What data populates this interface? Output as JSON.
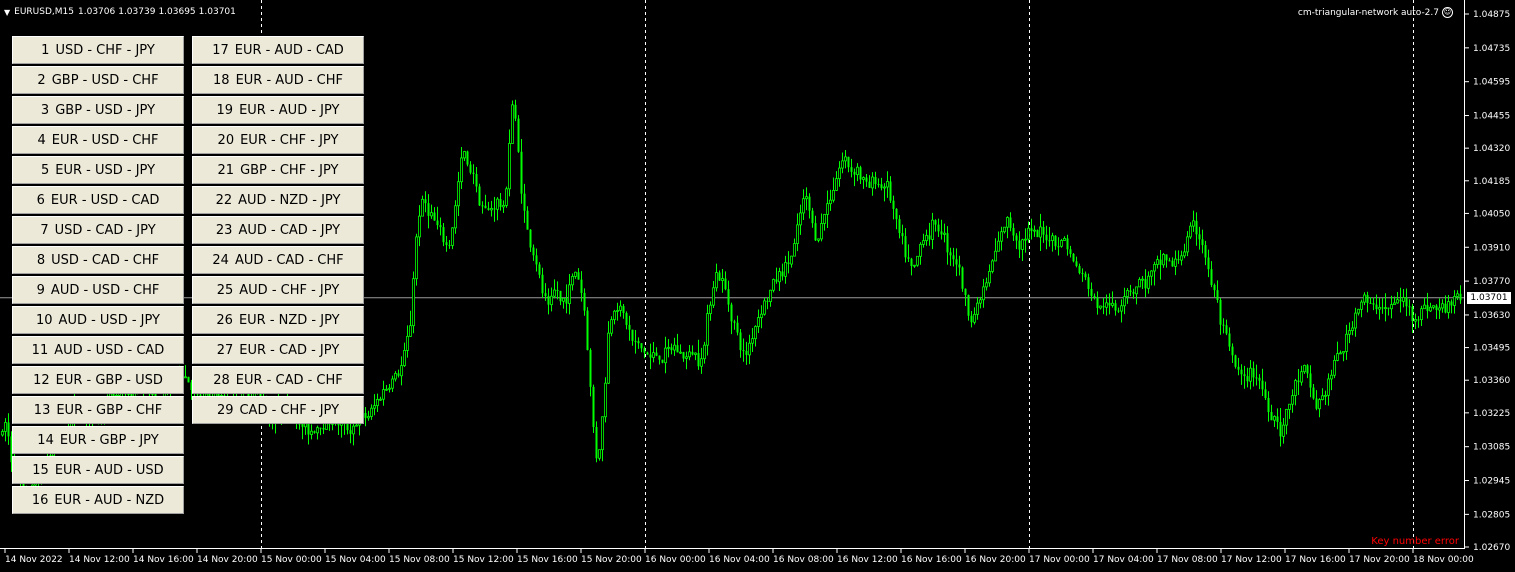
{
  "header": {
    "symbol": "EURUSD,M15",
    "quotes": [
      "1.03706",
      "1.03739",
      "1.03695",
      "1.03701"
    ]
  },
  "indicator": {
    "name": "cm-triangular-network auto-2.7",
    "icon": "smiley-icon"
  },
  "status_message": "Key number error",
  "triangles": [
    {
      "num": "1",
      "pair": "USD - CHF - JPY"
    },
    {
      "num": "2",
      "pair": "GBP - USD - CHF"
    },
    {
      "num": "3",
      "pair": "GBP - USD - JPY"
    },
    {
      "num": "4",
      "pair": "EUR - USD - CHF"
    },
    {
      "num": "5",
      "pair": "EUR - USD - JPY"
    },
    {
      "num": "6",
      "pair": "EUR - USD - CAD"
    },
    {
      "num": "7",
      "pair": "USD - CAD - JPY"
    },
    {
      "num": "8",
      "pair": "USD - CAD - CHF"
    },
    {
      "num": "9",
      "pair": "AUD - USD - CHF"
    },
    {
      "num": "10",
      "pair": "AUD - USD - JPY"
    },
    {
      "num": "11",
      "pair": "AUD - USD - CAD"
    },
    {
      "num": "12",
      "pair": "EUR - GBP - USD"
    },
    {
      "num": "13",
      "pair": "EUR - GBP - CHF"
    },
    {
      "num": "14",
      "pair": "EUR - GBP - JPY"
    },
    {
      "num": "15",
      "pair": "EUR - AUD - USD"
    },
    {
      "num": "16",
      "pair": "EUR - AUD - NZD"
    },
    {
      "num": "17",
      "pair": "EUR - AUD - CAD"
    },
    {
      "num": "18",
      "pair": "EUR - AUD - CHF"
    },
    {
      "num": "19",
      "pair": "EUR - AUD - JPY"
    },
    {
      "num": "20",
      "pair": "EUR - CHF - JPY"
    },
    {
      "num": "21",
      "pair": "GBP - CHF - JPY"
    },
    {
      "num": "22",
      "pair": "AUD - NZD - JPY"
    },
    {
      "num": "23",
      "pair": "AUD - CAD - JPY"
    },
    {
      "num": "24",
      "pair": "AUD - CAD - CHF"
    },
    {
      "num": "25",
      "pair": "AUD - CHF - JPY"
    },
    {
      "num": "26",
      "pair": "EUR - NZD - JPY"
    },
    {
      "num": "27",
      "pair": "EUR - CAD - JPY"
    },
    {
      "num": "28",
      "pair": "EUR - CAD - CHF"
    },
    {
      "num": "29",
      "pair": "CAD - CHF - JPY"
    }
  ],
  "colors": {
    "background": "#000000",
    "candle": "#00ff00",
    "grid": "#ffffff",
    "bid_line": "#c0c0c0",
    "error": "#ff0000",
    "button_face": "#ece9d8"
  },
  "chart_data": {
    "type": "candlestick",
    "symbol": "EURUSD",
    "timeframe": "M15",
    "current_price": "1.03701",
    "y_ticks": [
      "1.04875",
      "1.04735",
      "1.04595",
      "1.04455",
      "1.04320",
      "1.04185",
      "1.04050",
      "1.03910",
      "1.03770",
      "1.03630",
      "1.03495",
      "1.03360",
      "1.03225",
      "1.03085",
      "1.02945",
      "1.02805",
      "1.02670"
    ],
    "x_ticks": [
      "14 Nov 2022",
      "14 Nov 12:00",
      "14 Nov 16:00",
      "14 Nov 20:00",
      "15 Nov 00:00",
      "15 Nov 04:00",
      "15 Nov 08:00",
      "15 Nov 12:00",
      "15 Nov 16:00",
      "15 Nov 20:00",
      "16 Nov 00:00",
      "16 Nov 04:00",
      "16 Nov 08:00",
      "16 Nov 12:00",
      "16 Nov 16:00",
      "16 Nov 20:00",
      "17 Nov 00:00",
      "17 Nov 04:00",
      "17 Nov 08:00",
      "17 Nov 12:00",
      "17 Nov 16:00",
      "17 Nov 20:00",
      "18 Nov 00:00"
    ],
    "ylim": [
      1.0267,
      1.04875
    ],
    "grid": "dashed vertical at day boundaries",
    "close_path": [
      [
        0,
        1.031
      ],
      [
        6,
        1.032
      ],
      [
        10,
        1.0305
      ],
      [
        14,
        1.03
      ],
      [
        18,
        1.0295
      ],
      [
        22,
        1.029
      ],
      [
        26,
        1.0285
      ],
      [
        30,
        1.0288
      ],
      [
        36,
        1.0295
      ],
      [
        42,
        1.03
      ],
      [
        50,
        1.0305
      ],
      [
        60,
        1.0312
      ],
      [
        70,
        1.032
      ],
      [
        80,
        1.0326
      ],
      [
        90,
        1.0318
      ],
      [
        100,
        1.0322
      ],
      [
        110,
        1.0328
      ],
      [
        120,
        1.0332
      ],
      [
        130,
        1.033
      ],
      [
        140,
        1.0336
      ],
      [
        150,
        1.033
      ],
      [
        160,
        1.0325
      ],
      [
        170,
        1.0335
      ],
      [
        180,
        1.034
      ],
      [
        190,
        1.0335
      ],
      [
        200,
        1.0325
      ],
      [
        210,
        1.033
      ],
      [
        220,
        1.0328
      ],
      [
        230,
        1.0325
      ],
      [
        240,
        1.033
      ],
      [
        250,
        1.0332
      ],
      [
        260,
        1.0328
      ],
      [
        270,
        1.032
      ],
      [
        280,
        1.0325
      ],
      [
        290,
        1.0322
      ],
      [
        300,
        1.0318
      ],
      [
        310,
        1.0315
      ],
      [
        320,
        1.0318
      ],
      [
        330,
        1.032
      ],
      [
        340,
        1.0318
      ],
      [
        350,
        1.0316
      ],
      [
        360,
        1.032
      ],
      [
        370,
        1.0322
      ],
      [
        380,
        1.033
      ],
      [
        390,
        1.0335
      ],
      [
        400,
        1.034
      ],
      [
        405,
        1.0348
      ],
      [
        410,
        1.036
      ],
      [
        414,
        1.0385
      ],
      [
        418,
        1.0405
      ],
      [
        424,
        1.041
      ],
      [
        430,
        1.0405
      ],
      [
        436,
        1.04
      ],
      [
        442,
        1.0395
      ],
      [
        448,
        1.039
      ],
      [
        452,
        1.04
      ],
      [
        456,
        1.041
      ],
      [
        460,
        1.0425
      ],
      [
        464,
        1.043
      ],
      [
        468,
        1.0422
      ],
      [
        472,
        1.0425
      ],
      [
        476,
        1.0415
      ],
      [
        480,
        1.041
      ],
      [
        486,
        1.0405
      ],
      [
        492,
        1.0408
      ],
      [
        498,
        1.041
      ],
      [
        504,
        1.0405
      ],
      [
        508,
        1.043
      ],
      [
        512,
        1.045
      ],
      [
        516,
        1.044
      ],
      [
        520,
        1.042
      ],
      [
        524,
        1.0405
      ],
      [
        528,
        1.0395
      ],
      [
        532,
        1.039
      ],
      [
        536,
        1.0385
      ],
      [
        540,
        1.0375
      ],
      [
        544,
        1.037
      ],
      [
        548,
        1.0365
      ],
      [
        552,
        1.037
      ],
      [
        556,
        1.0375
      ],
      [
        560,
        1.0368
      ],
      [
        564,
        1.037
      ],
      [
        568,
        1.0372
      ],
      [
        572,
        1.0378
      ],
      [
        576,
        1.0382
      ],
      [
        580,
        1.0375
      ],
      [
        584,
        1.0365
      ],
      [
        588,
        1.0345
      ],
      [
        592,
        1.032
      ],
      [
        596,
        1.0305
      ],
      [
        600,
        1.031
      ],
      [
        604,
        1.033
      ],
      [
        608,
        1.0355
      ],
      [
        612,
        1.0365
      ],
      [
        616,
        1.0368
      ],
      [
        620,
        1.0365
      ],
      [
        626,
        1.036
      ],
      [
        632,
        1.0352
      ],
      [
        638,
        1.035
      ],
      [
        644,
        1.0348
      ],
      [
        650,
        1.0345
      ],
      [
        656,
        1.0347
      ],
      [
        662,
        1.0345
      ],
      [
        668,
        1.0348
      ],
      [
        674,
        1.035
      ],
      [
        680,
        1.0347
      ],
      [
        686,
        1.0345
      ],
      [
        692,
        1.0348
      ],
      [
        698,
        1.0345
      ],
      [
        704,
        1.035
      ],
      [
        708,
        1.0365
      ],
      [
        712,
        1.0375
      ],
      [
        716,
        1.038
      ],
      [
        720,
        1.0378
      ],
      [
        724,
        1.0375
      ],
      [
        728,
        1.0368
      ],
      [
        732,
        1.0362
      ],
      [
        736,
        1.0356
      ],
      [
        740,
        1.035
      ],
      [
        744,
        1.0345
      ],
      [
        748,
        1.035
      ],
      [
        752,
        1.0355
      ],
      [
        756,
        1.036
      ],
      [
        760,
        1.0365
      ],
      [
        764,
        1.0368
      ],
      [
        768,
        1.037
      ],
      [
        772,
        1.0375
      ],
      [
        776,
        1.0378
      ],
      [
        780,
        1.038
      ],
      [
        784,
        1.0382
      ],
      [
        788,
        1.0385
      ],
      [
        792,
        1.0388
      ],
      [
        796,
        1.0395
      ],
      [
        800,
        1.0405
      ],
      [
        804,
        1.0412
      ],
      [
        808,
        1.0408
      ],
      [
        812,
        1.04
      ],
      [
        816,
        1.0395
      ],
      [
        820,
        1.0398
      ],
      [
        824,
        1.0405
      ],
      [
        828,
        1.041
      ],
      [
        832,
        1.0415
      ],
      [
        836,
        1.042
      ],
      [
        840,
        1.0425
      ],
      [
        844,
        1.0428
      ],
      [
        848,
        1.0425
      ],
      [
        852,
        1.0422
      ],
      [
        856,
        1.0425
      ],
      [
        860,
        1.042
      ],
      [
        864,
        1.0418
      ],
      [
        868,
        1.0415
      ],
      [
        872,
        1.0418
      ],
      [
        876,
        1.042
      ],
      [
        880,
        1.0415
      ],
      [
        884,
        1.0418
      ],
      [
        888,
        1.0415
      ],
      [
        892,
        1.0408
      ],
      [
        896,
        1.04
      ],
      [
        900,
        1.0395
      ],
      [
        904,
        1.039
      ],
      [
        908,
        1.0385
      ],
      [
        912,
        1.038
      ],
      [
        916,
        1.0385
      ],
      [
        920,
        1.0392
      ],
      [
        924,
        1.0398
      ],
      [
        928,
        1.0395
      ],
      [
        932,
        1.04
      ],
      [
        936,
        1.0398
      ],
      [
        940,
        1.04
      ],
      [
        944,
        1.0395
      ],
      [
        948,
        1.039
      ],
      [
        952,
        1.0388
      ],
      [
        956,
        1.0385
      ],
      [
        960,
        1.038
      ],
      [
        964,
        1.037
      ],
      [
        968,
        1.0365
      ],
      [
        972,
        1.0362
      ],
      [
        976,
        1.0365
      ],
      [
        980,
        1.037
      ],
      [
        984,
        1.0375
      ],
      [
        988,
        1.0378
      ],
      [
        992,
        1.0385
      ],
      [
        996,
        1.039
      ],
      [
        1000,
        1.0395
      ],
      [
        1004,
        1.04
      ],
      [
        1008,
        1.0402
      ],
      [
        1012,
        1.0398
      ],
      [
        1016,
        1.0395
      ],
      [
        1020,
        1.0392
      ],
      [
        1024,
        1.0395
      ],
      [
        1028,
        1.0398
      ],
      [
        1032,
        1.0396
      ],
      [
        1036,
        1.0395
      ],
      [
        1040,
        1.0397
      ],
      [
        1044,
        1.0395
      ],
      [
        1048,
        1.0396
      ],
      [
        1052,
        1.0395
      ],
      [
        1056,
        1.0393
      ],
      [
        1060,
        1.0392
      ],
      [
        1064,
        1.0395
      ],
      [
        1068,
        1.039
      ],
      [
        1072,
        1.0385
      ],
      [
        1076,
        1.0383
      ],
      [
        1080,
        1.038
      ],
      [
        1084,
        1.0378
      ],
      [
        1088,
        1.0375
      ],
      [
        1092,
        1.037
      ],
      [
        1096,
        1.0368
      ],
      [
        1100,
        1.0365
      ],
      [
        1104,
        1.0368
      ],
      [
        1108,
        1.0365
      ],
      [
        1112,
        1.0368
      ],
      [
        1116,
        1.0365
      ],
      [
        1120,
        1.0368
      ],
      [
        1124,
        1.0372
      ],
      [
        1128,
        1.0375
      ],
      [
        1132,
        1.0372
      ],
      [
        1136,
        1.0375
      ],
      [
        1140,
        1.0378
      ],
      [
        1144,
        1.0375
      ],
      [
        1148,
        1.0378
      ],
      [
        1152,
        1.038
      ],
      [
        1156,
        1.0383
      ],
      [
        1160,
        1.0385
      ],
      [
        1164,
        1.0388
      ],
      [
        1168,
        1.0385
      ],
      [
        1172,
        1.0383
      ],
      [
        1176,
        1.0385
      ],
      [
        1180,
        1.0388
      ],
      [
        1184,
        1.039
      ],
      [
        1188,
        1.0395
      ],
      [
        1192,
        1.04
      ],
      [
        1196,
        1.0398
      ],
      [
        1200,
        1.0395
      ],
      [
        1204,
        1.039
      ],
      [
        1208,
        1.038
      ],
      [
        1212,
        1.0375
      ],
      [
        1216,
        1.037
      ],
      [
        1220,
        1.036
      ],
      [
        1224,
        1.0355
      ],
      [
        1228,
        1.035
      ],
      [
        1232,
        1.0345
      ],
      [
        1236,
        1.034
      ],
      [
        1240,
        1.0338
      ],
      [
        1244,
        1.0335
      ],
      [
        1248,
        1.0338
      ],
      [
        1252,
        1.034
      ],
      [
        1256,
        1.0338
      ],
      [
        1260,
        1.0335
      ],
      [
        1264,
        1.033
      ],
      [
        1268,
        1.0325
      ],
      [
        1272,
        1.032
      ],
      [
        1276,
        1.0322
      ],
      [
        1280,
        1.0315
      ],
      [
        1284,
        1.0318
      ],
      [
        1288,
        1.0325
      ],
      [
        1292,
        1.033
      ],
      [
        1296,
        1.0335
      ],
      [
        1300,
        1.0338
      ],
      [
        1304,
        1.034
      ],
      [
        1308,
        1.0335
      ],
      [
        1312,
        1.033
      ],
      [
        1316,
        1.0325
      ],
      [
        1320,
        1.0328
      ],
      [
        1324,
        1.033
      ],
      [
        1328,
        1.0335
      ],
      [
        1332,
        1.034
      ],
      [
        1336,
        1.0345
      ],
      [
        1340,
        1.0348
      ],
      [
        1344,
        1.035
      ],
      [
        1348,
        1.0355
      ],
      [
        1352,
        1.036
      ],
      [
        1356,
        1.0365
      ],
      [
        1360,
        1.0368
      ],
      [
        1364,
        1.037
      ],
      [
        1368,
        1.0367
      ],
      [
        1372,
        1.0365
      ],
      [
        1376,
        1.0367
      ],
      [
        1380,
        1.0368
      ],
      [
        1384,
        1.0366
      ],
      [
        1388,
        1.0365
      ],
      [
        1392,
        1.0367
      ],
      [
        1396,
        1.0368
      ],
      [
        1400,
        1.037
      ],
      [
        1404,
        1.0368
      ],
      [
        1408,
        1.0366
      ],
      [
        1412,
        1.0363
      ],
      [
        1416,
        1.0362
      ],
      [
        1420,
        1.0364
      ],
      [
        1424,
        1.0366
      ],
      [
        1428,
        1.0367
      ],
      [
        1432,
        1.0366
      ],
      [
        1436,
        1.0365
      ],
      [
        1440,
        1.0366
      ],
      [
        1444,
        1.0365
      ],
      [
        1448,
        1.0367
      ],
      [
        1452,
        1.037
      ],
      [
        1456,
        1.0372
      ],
      [
        1460,
        1.037
      ]
    ]
  }
}
